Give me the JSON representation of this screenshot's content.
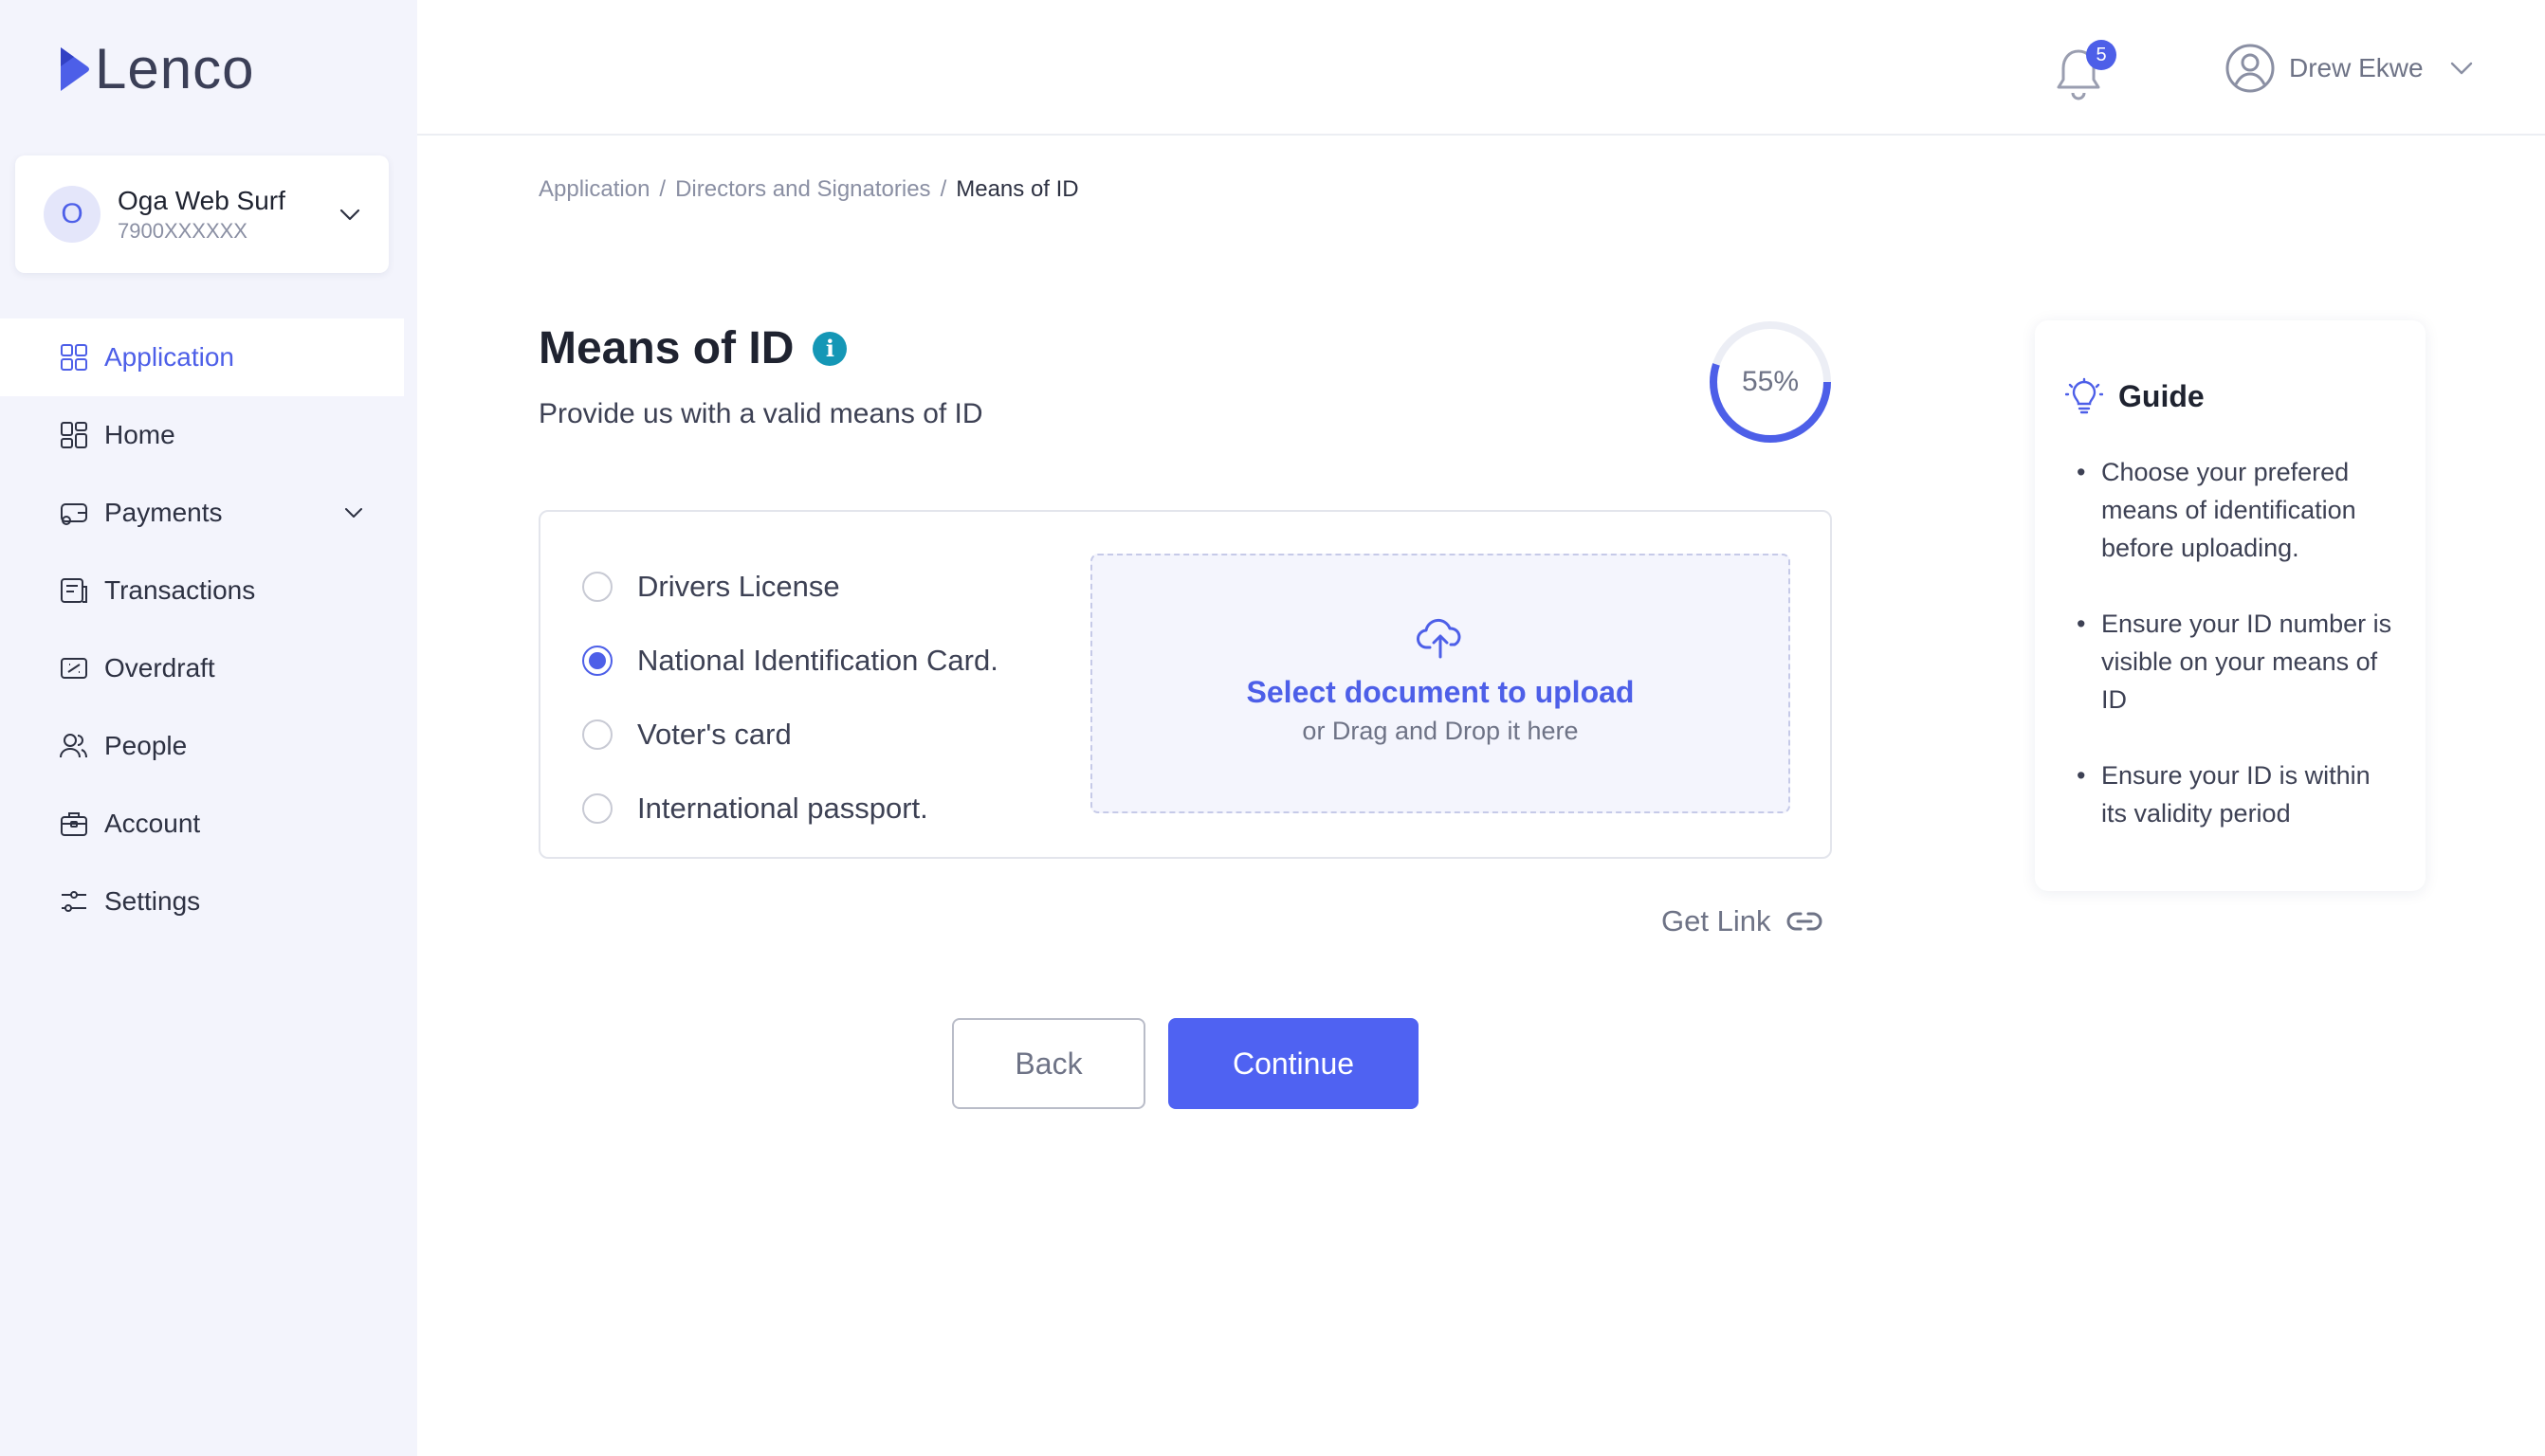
{
  "app": {
    "logo_text": "Lenco",
    "brand_color": "#4d5fe8"
  },
  "org": {
    "avatar_letter": "O",
    "name": "Oga Web Surf",
    "number": "7900XXXXXX"
  },
  "sidebar": {
    "items": [
      {
        "label": "Application",
        "icon": "application-icon",
        "active": true
      },
      {
        "label": "Home",
        "icon": "home-icon"
      },
      {
        "label": "Payments",
        "icon": "payments-icon",
        "has_submenu": true
      },
      {
        "label": "Transactions",
        "icon": "transactions-icon"
      },
      {
        "label": "Overdraft",
        "icon": "overdraft-icon"
      },
      {
        "label": "People",
        "icon": "people-icon"
      },
      {
        "label": "Account",
        "icon": "account-icon"
      },
      {
        "label": "Settings",
        "icon": "settings-icon"
      }
    ]
  },
  "header": {
    "notification_count": "5",
    "user_name": "Drew Ekwe"
  },
  "breadcrumb": {
    "items": [
      "Application",
      "Directors and Signatories",
      "Means of ID"
    ],
    "separator": "/"
  },
  "page": {
    "title": "Means of ID",
    "info_icon": "i",
    "subtitle": "Provide us with a valid means of ID",
    "progress_label": "55%",
    "progress_value": 0.55
  },
  "id_options": {
    "options": [
      {
        "label": "Drivers License",
        "checked": false
      },
      {
        "label": "National Identification Card.",
        "checked": true
      },
      {
        "label": "Voter's card",
        "checked": false
      },
      {
        "label": "International passport.",
        "checked": false
      }
    ]
  },
  "upload": {
    "title": "Select document to upload",
    "subtitle": "or Drag and Drop it here"
  },
  "get_link": {
    "label": "Get Link"
  },
  "buttons": {
    "back": "Back",
    "continue": "Continue"
  },
  "guide": {
    "title": "Guide",
    "items": [
      "Choose your prefered means of identification before uploading.",
      "Ensure your ID number is visible on your means of ID",
      "Ensure your ID is within its validity period"
    ]
  }
}
